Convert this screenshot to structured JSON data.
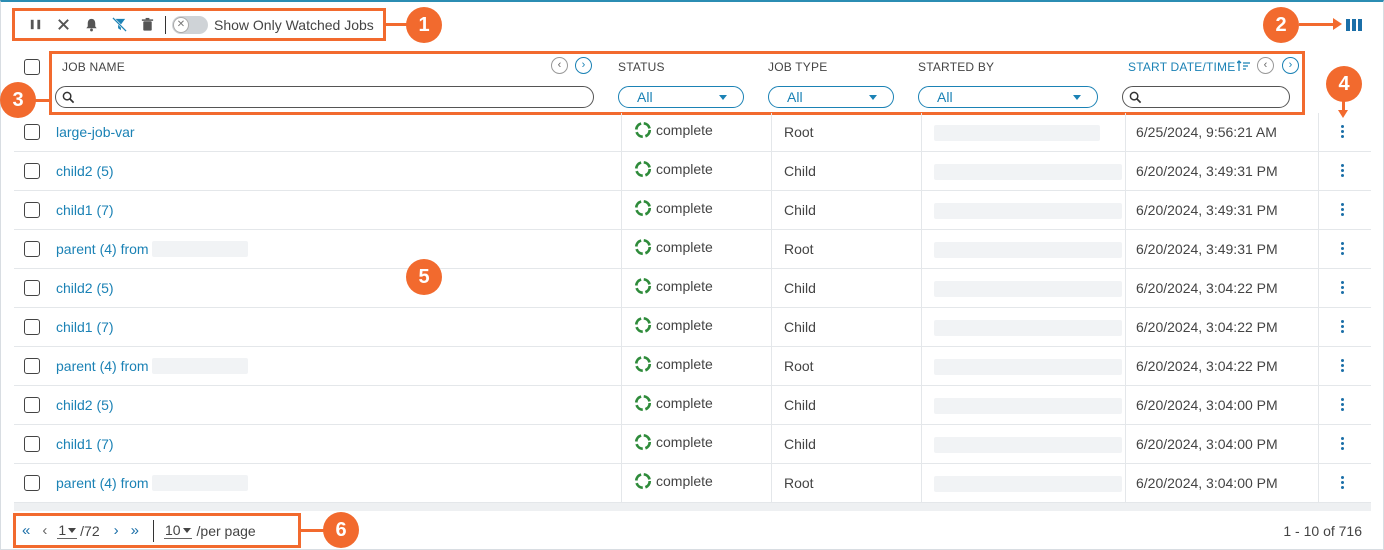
{
  "toolbar": {
    "icons": [
      "pause-icon",
      "close-icon",
      "bell-icon",
      "filter-clear-icon",
      "trash-icon"
    ],
    "toggle_state": "off",
    "toggle_label": "Show Only Watched Jobs"
  },
  "annotations": {
    "m1": "1",
    "m2": "2",
    "m3": "3",
    "m4": "4",
    "m5": "5",
    "m6": "6",
    "color": "#f26a2e"
  },
  "columns": {
    "job_name": "JOB NAME",
    "status": "STATUS",
    "job_type": "JOB TYPE",
    "started_by": "STARTED BY",
    "start_datetime": "START DATE/TIME"
  },
  "filters": {
    "status": "All",
    "job_type": "All",
    "started_by": "All"
  },
  "rows": [
    {
      "name": "large-job-var",
      "status": "complete",
      "type": "Root",
      "date": "6/25/2024, 9:56:21 AM"
    },
    {
      "name": "child2 (5)",
      "status": "complete",
      "type": "Child",
      "date": "6/20/2024, 3:49:31 PM"
    },
    {
      "name": "child1 (7)",
      "status": "complete",
      "type": "Child",
      "date": "6/20/2024, 3:49:31 PM"
    },
    {
      "name": "parent (4) from",
      "status": "complete",
      "type": "Root",
      "date": "6/20/2024, 3:49:31 PM"
    },
    {
      "name": "child2 (5)",
      "status": "complete",
      "type": "Child",
      "date": "6/20/2024, 3:04:22 PM"
    },
    {
      "name": "child1 (7)",
      "status": "complete",
      "type": "Child",
      "date": "6/20/2024, 3:04:22 PM"
    },
    {
      "name": "parent (4) from",
      "status": "complete",
      "type": "Root",
      "date": "6/20/2024, 3:04:22 PM"
    },
    {
      "name": "child2 (5)",
      "status": "complete",
      "type": "Child",
      "date": "6/20/2024, 3:04:00 PM"
    },
    {
      "name": "child1 (7)",
      "status": "complete",
      "type": "Child",
      "date": "6/20/2024, 3:04:00 PM"
    },
    {
      "name": "parent (4) from",
      "status": "complete",
      "type": "Root",
      "date": "6/20/2024, 3:04:00 PM"
    }
  ],
  "pager": {
    "page": "1",
    "total_pages": "/72",
    "per_page": "10",
    "per_page_label": "/per page",
    "summary": "1 - 10 of 716"
  },
  "colors": {
    "accent": "#1b82b5",
    "status_complete": "#2e8b3a"
  }
}
